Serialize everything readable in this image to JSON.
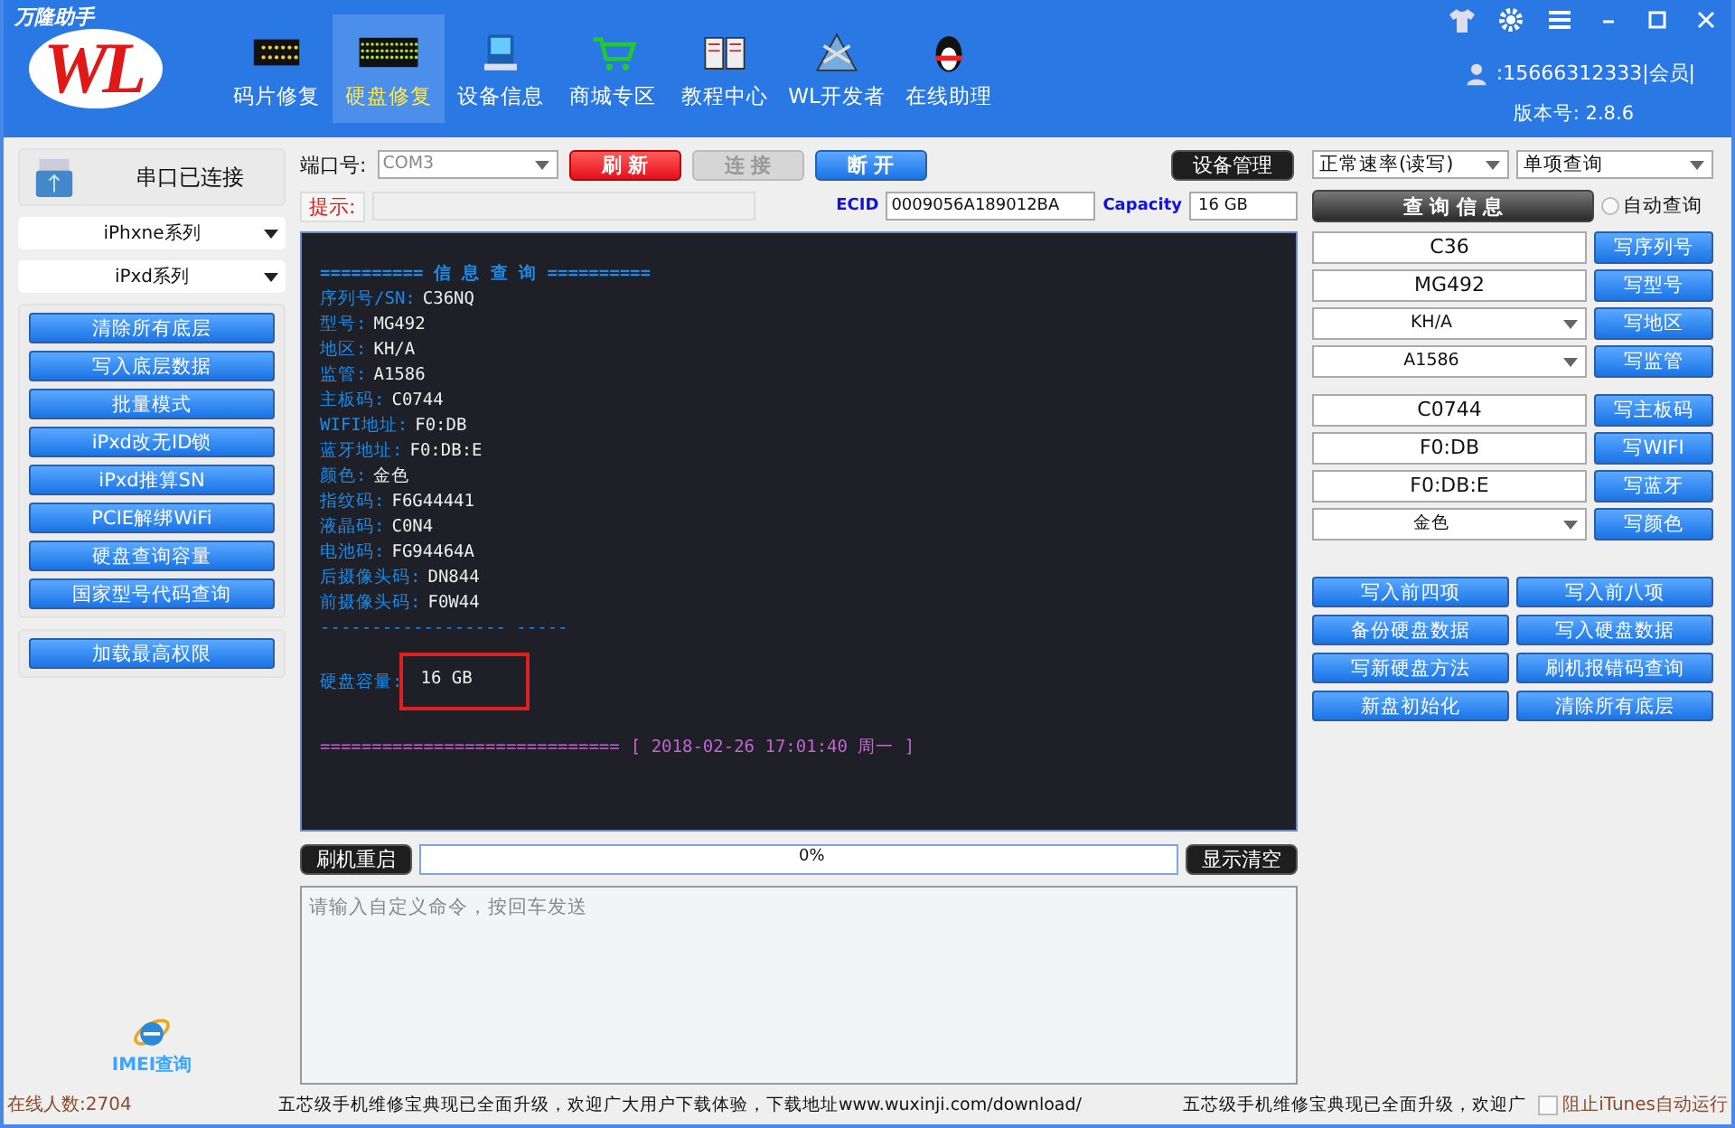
{
  "header": {
    "brand_caption": "万隆助手",
    "brand_logo": "WL",
    "nav": [
      {
        "label": "码片修复",
        "selected": false
      },
      {
        "label": "硬盘修复",
        "selected": true
      },
      {
        "label": "设备信息",
        "selected": false
      },
      {
        "label": "商城专区",
        "selected": false
      },
      {
        "label": "教程中心",
        "selected": false
      },
      {
        "label": "WL开发者",
        "selected": false
      },
      {
        "label": "在线助理",
        "selected": false
      }
    ],
    "user": ":15666312333|会员|",
    "version": "版本号: 2.8.6"
  },
  "sidebar": {
    "connection": "串口已连接",
    "selects": [
      "iPhxne系列",
      "iPxd系列"
    ],
    "buttons": [
      "清除所有底层",
      "写入底层数据",
      "批量模式",
      "iPxd改无ID锁",
      "iPxd推算SN",
      "PCIE解绑WiFi",
      "硬盘查询容量",
      "国家型号代码查询"
    ],
    "extra_button": "加载最高权限",
    "imei_link": "IMEI查询"
  },
  "toolbar": {
    "port_label": "端口号:",
    "port": "COM3",
    "buttons": [
      {
        "label": "刷 新",
        "kind": "red",
        "disabled": false
      },
      {
        "label": "连 接",
        "kind": "blue",
        "disabled": true
      },
      {
        "label": "断 开",
        "kind": "blue",
        "disabled": false
      }
    ],
    "device_button": "设备管理",
    "hint_label": "提示:",
    "ecid_label": "ECID",
    "ecid": "0009056A189012BA",
    "capacity_label": "Capacity",
    "capacity": "16 GB"
  },
  "terminal": {
    "title": "========== 信 息 查 询 ==========",
    "lines": [
      {
        "label": "序列号/SN:",
        "value": "C36NQ"
      },
      {
        "label": "型号:",
        "value": "MG492"
      },
      {
        "label": "地区:",
        "value": "KH/A"
      },
      {
        "label": "监管:",
        "value": "A1586"
      },
      {
        "label": "主板码:",
        "value": "C0744"
      },
      {
        "label": "WIFI地址:",
        "value": "F0:DB"
      },
      {
        "label": "蓝牙地址:",
        "value": "F0:DB:E"
      },
      {
        "label": "颜色:",
        "value": "金色"
      },
      {
        "label": "指纹码:",
        "value": "F6G44441"
      },
      {
        "label": "液晶码:",
        "value": "C0N4"
      },
      {
        "label": "电池码:",
        "value": "FG94464A"
      },
      {
        "label": "后摄像头码:",
        "value": "DN844"
      },
      {
        "label": "前摄像头码:",
        "value": "F0W44"
      }
    ],
    "separator": "------------------          -----",
    "capacity_label": "硬盘容量:",
    "capacity": "16 GB",
    "footer_rule": "=============================",
    "footer_time": "[ 2018-02-26 17:01:40 周一 ]"
  },
  "progress": {
    "restart_button": "刷机重启",
    "level": 0,
    "reading": "0%",
    "clear_button": "显示清空"
  },
  "command": {
    "placeholder": "请输入自定义命令，按回车发送"
  },
  "right": {
    "selects": [
      "正常速率(读写)",
      "单项查询"
    ],
    "query_button": "查 询 信 息",
    "auto_query": {
      "label": "自动查询",
      "selected": false
    },
    "fields": [
      {
        "kind": "input",
        "value": "C36",
        "button": "写序列号"
      },
      {
        "kind": "input",
        "value": "MG492",
        "button": "写型号"
      },
      {
        "kind": "select",
        "value": "KH/A",
        "button": "写地区"
      },
      {
        "kind": "select",
        "value": "A1586",
        "button": "写监管"
      },
      {
        "kind": "input",
        "value": "C0744",
        "button": "写主板码"
      },
      {
        "kind": "input",
        "value": "F0:DB",
        "button": "写WIFI"
      },
      {
        "kind": "input",
        "value": "F0:DB:E",
        "button": "写蓝牙"
      },
      {
        "kind": "select",
        "value": "金色",
        "button": "写颜色"
      }
    ],
    "buttons": [
      "写入前四项",
      "写入前八项",
      "备份硬盘数据",
      "写入硬盘数据",
      "写新硬盘方法",
      "刷机报错码查询",
      "新盘初始化",
      "清除所有底层"
    ]
  },
  "status_bar": {
    "online": "在线人数:2704",
    "ticker": "五芯级手机维修宝典现已全面升级，欢迎广大用户下载体验，下载地址www.wuxinji.com/download/",
    "ticker_repeat": "五芯级手机维修宝典现已全面升级，欢迎广",
    "itunes": {
      "label": "阻止iTunes自动运行",
      "checked": false
    }
  }
}
